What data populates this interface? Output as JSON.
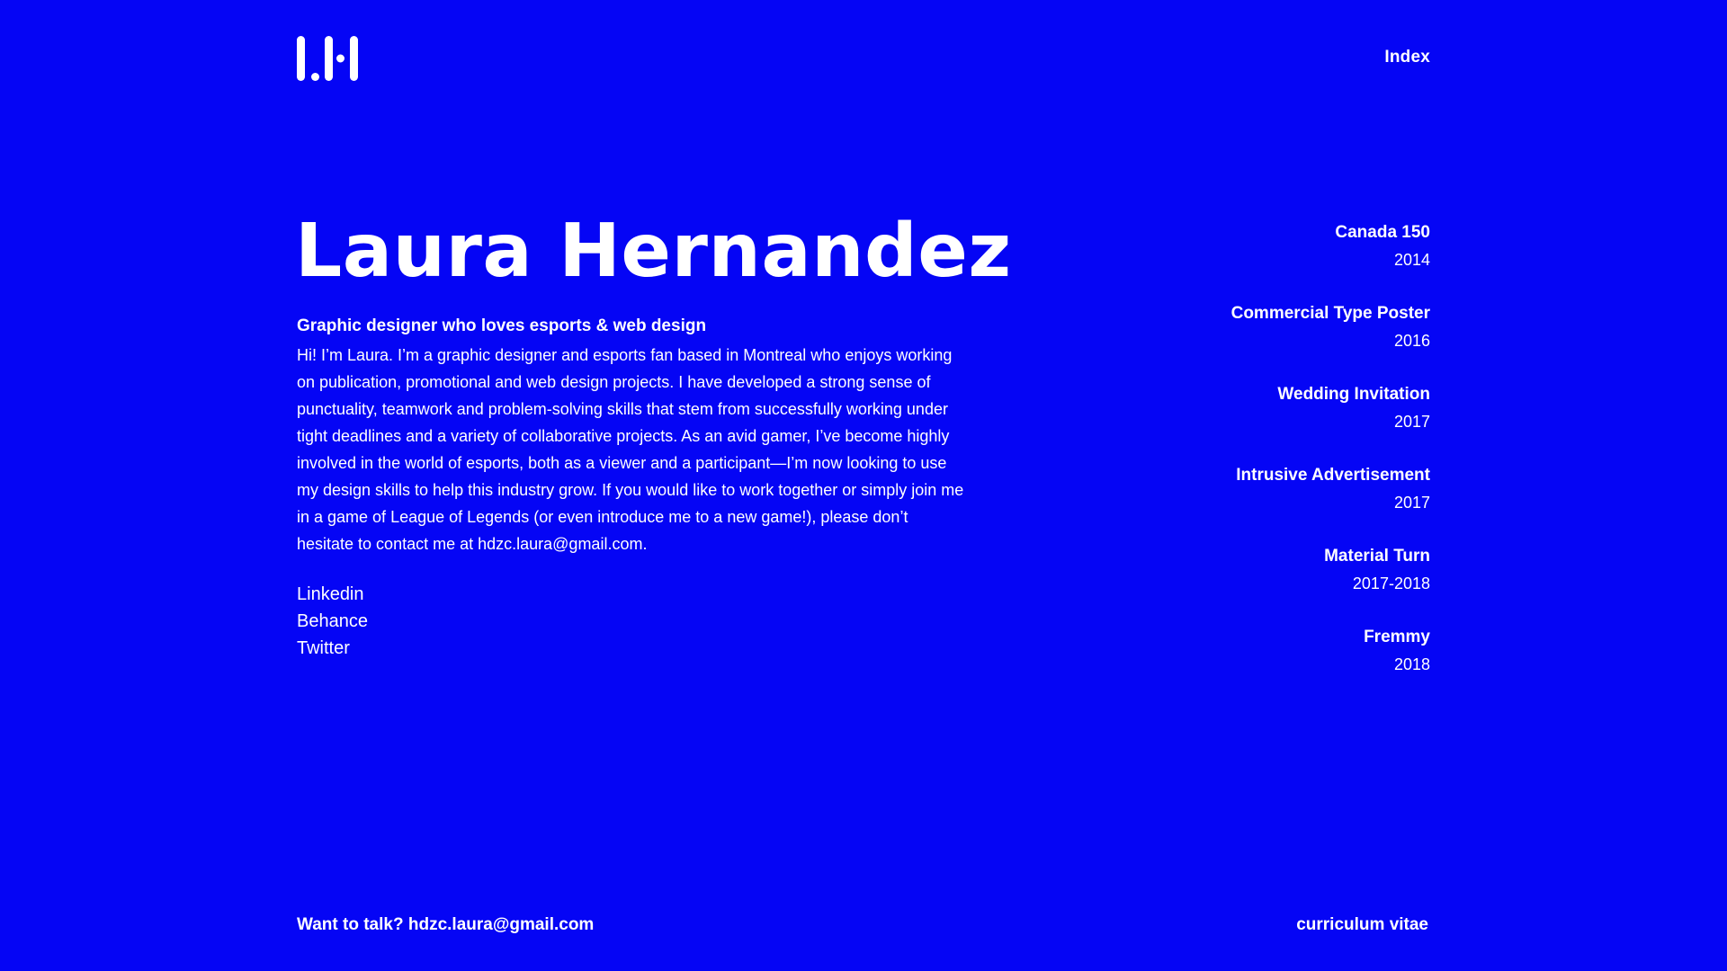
{
  "brand": {
    "logo_icon": "lh-monogram-logo"
  },
  "nav": {
    "index_label": "Index"
  },
  "hero": {
    "name": "Laura Hernandez",
    "tagline": "Graphic designer who loves esports & web design",
    "bio": "Hi! I’m Laura. I’m a graphic designer and esports fan based in Montreal who enjoys working on publication, promotional and web design projects. I have developed a strong sense of punctuality, teamwork and problem-solving skills that stem from successfully working under tight deadlines and a variety of collaborative projects. As an avid gamer, I’ve become highly involved in the world of esports, both as a viewer and a participant—I’m now looking to use my design skills to help this industry grow. If you would like to work together or simply join me in a game of League of Legends (or even introduce me to a new game!), please don’t hesitate to contact me at hdzc.laura@gmail.com."
  },
  "social": [
    {
      "label": "Linkedin"
    },
    {
      "label": "Behance"
    },
    {
      "label": "Twitter"
    }
  ],
  "projects": [
    {
      "title": "Canada 150",
      "year": "2014"
    },
    {
      "title": "Commercial Type Poster",
      "year": "2016"
    },
    {
      "title": "Wedding Invitation",
      "year": "2017"
    },
    {
      "title": "Intrusive Advertisement",
      "year": "2017"
    },
    {
      "title": "Material Turn",
      "year": "2017-2018"
    },
    {
      "title": "Fremmy",
      "year": "2018"
    }
  ],
  "footer": {
    "contact_prefix": "Want to talk?",
    "email": "hdzc.laura@gmail.com",
    "cv_label": "curriculum vitae"
  },
  "colors": {
    "background": "#0505F5",
    "foreground": "#FFFFFF"
  }
}
